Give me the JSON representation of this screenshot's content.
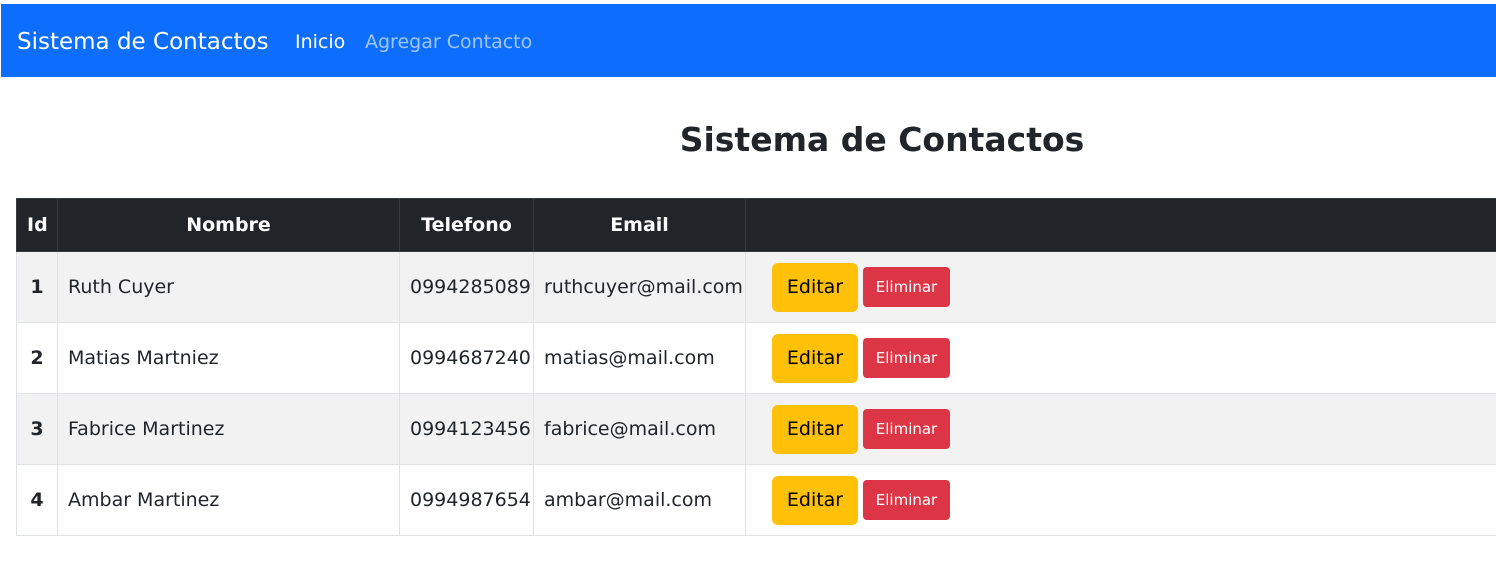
{
  "navbar": {
    "brand": "Sistema de Contactos",
    "links": [
      {
        "label": "Inicio",
        "state": "active"
      },
      {
        "label": "Agregar Contacto",
        "state": "inactive"
      }
    ],
    "colors": {
      "background": "#0d6efd"
    }
  },
  "main": {
    "title": "Sistema de Contactos"
  },
  "table": {
    "headers": [
      "Id",
      "Nombre",
      "Telefono",
      "Email",
      ""
    ],
    "rows": [
      {
        "id": "1",
        "nombre": "Ruth Cuyer",
        "telefono": "0994285089",
        "email": "ruthcuyer@mail.com"
      },
      {
        "id": "2",
        "nombre": "Matias Martniez",
        "telefono": "0994687240",
        "email": "matias@mail.com"
      },
      {
        "id": "3",
        "nombre": "Fabrice Martinez",
        "telefono": "0994123456",
        "email": "fabrice@mail.com"
      },
      {
        "id": "4",
        "nombre": "Ambar Martinez",
        "telefono": "0994987654",
        "email": "ambar@mail.com"
      }
    ],
    "actions": {
      "edit_label": "Editar",
      "delete_label": "Eliminar",
      "edit_color": "#ffc107",
      "delete_color": "#dc3545"
    },
    "colors": {
      "header_background": "#212529",
      "striped_row": "#f2f2f2"
    }
  }
}
